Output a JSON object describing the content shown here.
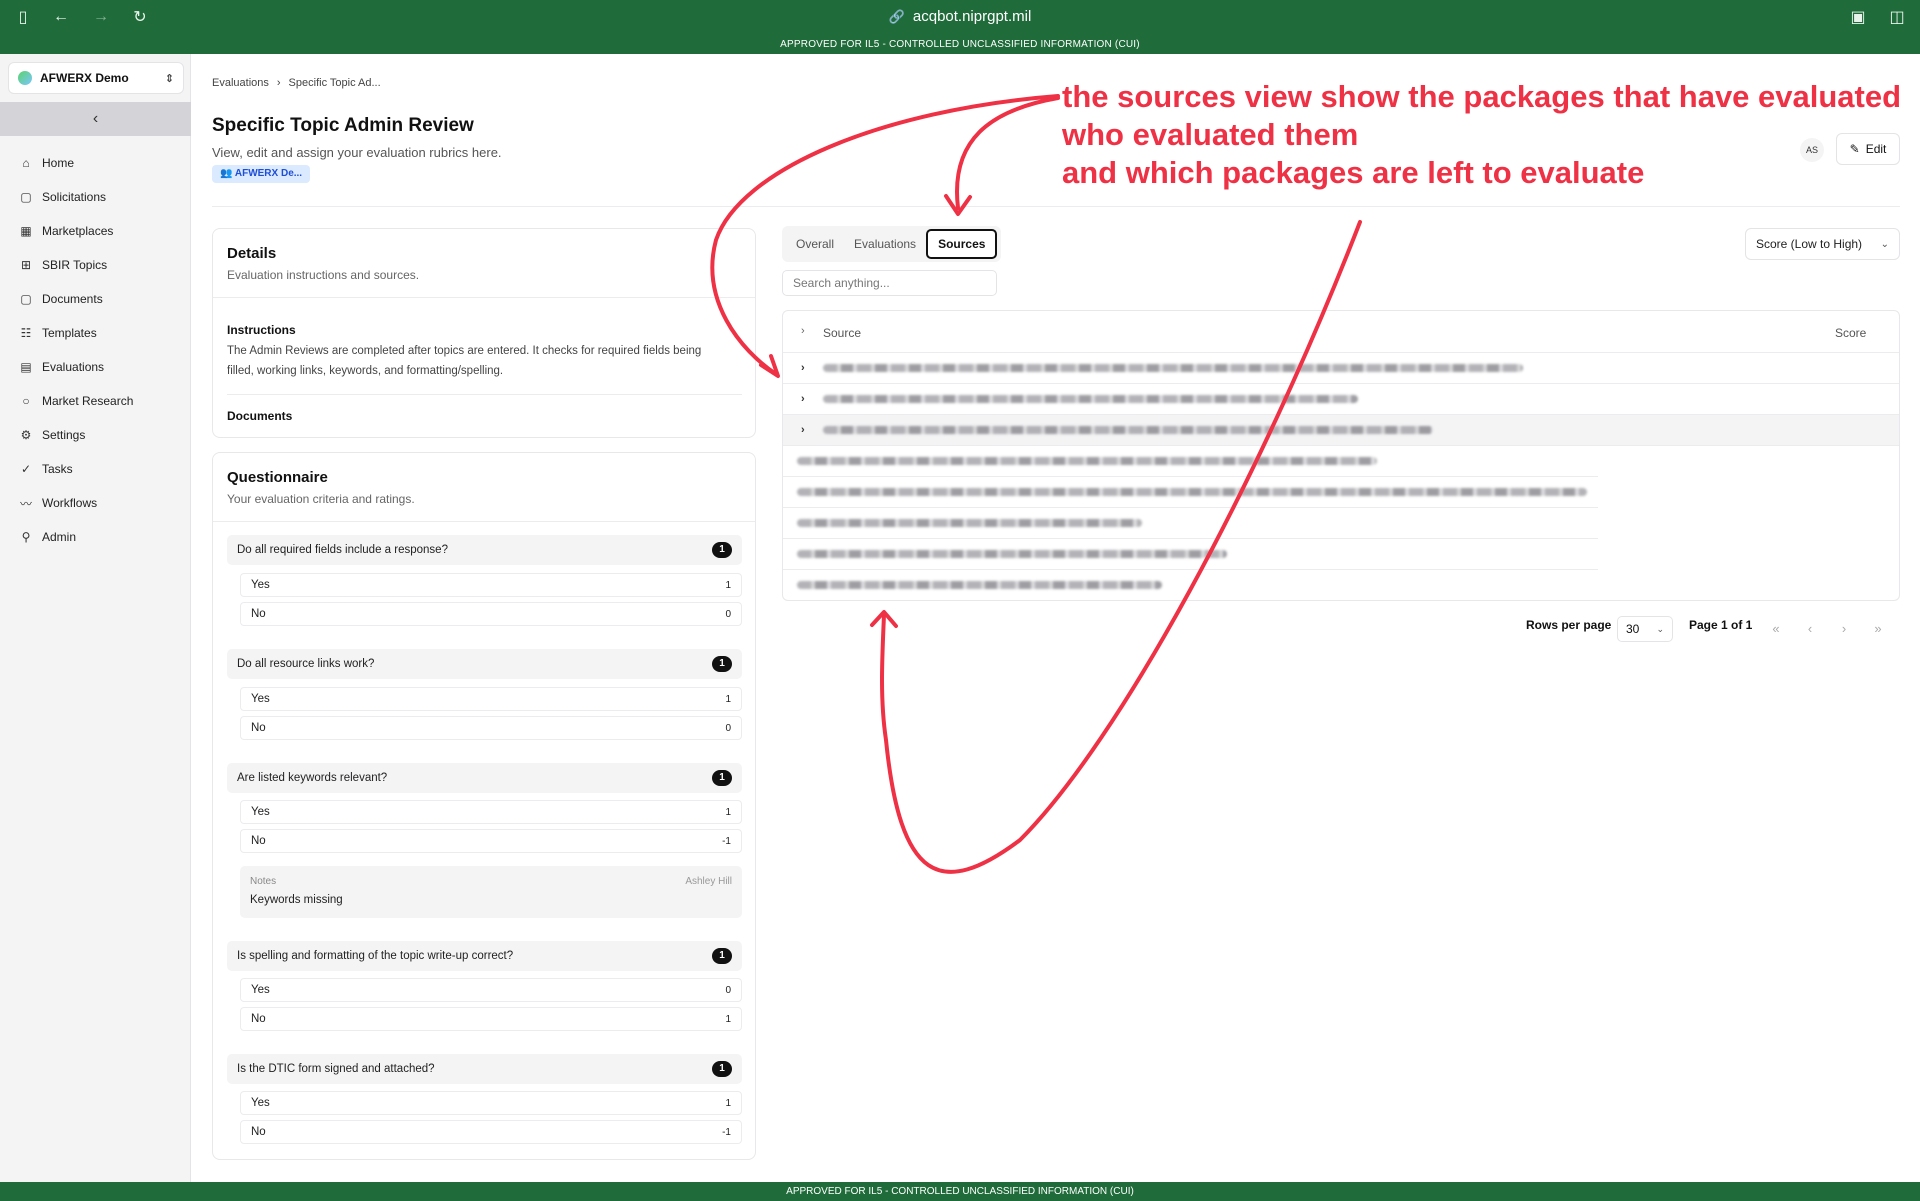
{
  "browser": {
    "url": "acqbot.niprgpt.mil",
    "banner_top": "APPROVED FOR IL5 - CONTROLLED UNCLASSIFIED INFORMATION (CUI)",
    "banner_bottom": "APPROVED FOR IL5 - CONTROLLED UNCLASSIFIED INFORMATION (CUI)",
    "theme_color": "#1f6b3a"
  },
  "sidebar": {
    "org_name": "AFWERX Demo",
    "items": [
      {
        "label": "Home",
        "icon": "home-icon"
      },
      {
        "label": "Solicitations",
        "icon": "document-icon"
      },
      {
        "label": "Marketplaces",
        "icon": "store-icon"
      },
      {
        "label": "SBIR Topics",
        "icon": "grid-icon"
      },
      {
        "label": "Documents",
        "icon": "file-icon"
      },
      {
        "label": "Templates",
        "icon": "template-icon"
      },
      {
        "label": "Evaluations",
        "icon": "clipboard-icon"
      },
      {
        "label": "Market Research",
        "icon": "search-icon"
      },
      {
        "label": "Settings",
        "icon": "gear-icon"
      },
      {
        "label": "Tasks",
        "icon": "check-icon"
      },
      {
        "label": "Workflows",
        "icon": "trend-icon"
      },
      {
        "label": "Admin",
        "icon": "user-icon"
      }
    ]
  },
  "header": {
    "breadcrumb_1": "Evaluations",
    "breadcrumb_sep": "›",
    "breadcrumb_2": "Specific Topic Ad...",
    "title": "Specific Topic Admin Review",
    "subtitle": "View, edit and assign your evaluation rubrics here.",
    "org_chip": "AFWERX De...",
    "avatar": "AS",
    "edit_label": "Edit"
  },
  "details": {
    "title": "Details",
    "subtitle": "Evaluation instructions and sources.",
    "instructions_title": "Instructions",
    "instructions_text": "The Admin Reviews are completed after topics are entered. It checks for required fields being filled, working links, keywords, and formatting/spelling.",
    "documents_title": "Documents"
  },
  "questionnaire": {
    "title": "Questionnaire",
    "subtitle": "Your evaluation criteria and ratings.",
    "questions": [
      {
        "text": "Do all required fields include a response?",
        "badge": "1",
        "options": [
          {
            "label": "Yes",
            "value": "1"
          },
          {
            "label": "No",
            "value": "0"
          }
        ]
      },
      {
        "text": "Do all resource links work?",
        "badge": "1",
        "options": [
          {
            "label": "Yes",
            "value": "1"
          },
          {
            "label": "No",
            "value": "0"
          }
        ]
      },
      {
        "text": "Are listed keywords relevant?",
        "badge": "1",
        "options": [
          {
            "label": "Yes",
            "value": "1"
          },
          {
            "label": "No",
            "value": "-1"
          }
        ],
        "notes": {
          "label": "Notes",
          "author": "Ashley Hill",
          "text": "Keywords missing"
        }
      },
      {
        "text": "Is spelling and formatting of the topic write-up correct?",
        "badge": "1",
        "options": [
          {
            "label": "Yes",
            "value": "0"
          },
          {
            "label": "No",
            "value": "1"
          }
        ]
      },
      {
        "text": "Is the DTIC form signed and attached?",
        "badge": "1",
        "options": [
          {
            "label": "Yes",
            "value": "1"
          },
          {
            "label": "No",
            "value": "-1"
          }
        ]
      }
    ]
  },
  "results": {
    "tabs": [
      "Overall",
      "Evaluations",
      "Sources"
    ],
    "active_tab": "Sources",
    "search_placeholder": "Search anything...",
    "sort_label": "Score (Low to High)",
    "columns": {
      "source": "Source",
      "score": "Score"
    },
    "row_count": 8,
    "pager": {
      "rows_label": "Rows per page",
      "rows_value": "30",
      "page_label": "Page 1 of 1"
    }
  },
  "annotation": {
    "line1": "the sources view show the packages that have evaluated",
    "line2": "who evaluated them",
    "line3": "and which packages are left to evaluate",
    "color": "#ee3144"
  }
}
